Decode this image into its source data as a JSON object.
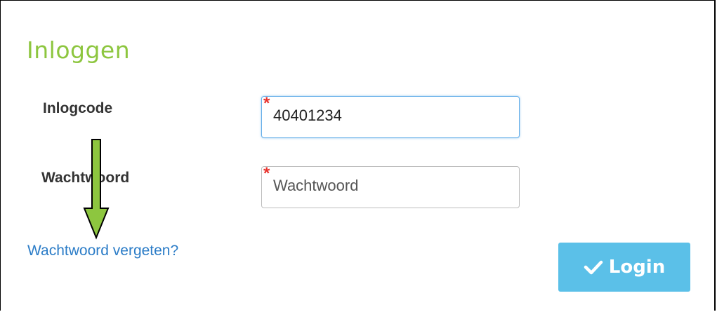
{
  "title": "Inloggen",
  "fields": {
    "code": {
      "label": "Inlogcode",
      "value": "40401234",
      "required_mark": "*"
    },
    "password": {
      "label": "Wachtwoord",
      "placeholder": "Wachtwoord",
      "required_mark": "*"
    }
  },
  "forgot_link": "Wachtwoord vergeten?",
  "login_button": {
    "label": "Login",
    "icon": "check-icon"
  },
  "annotation": {
    "icon": "down-arrow-icon",
    "color": "#8dc63f"
  }
}
